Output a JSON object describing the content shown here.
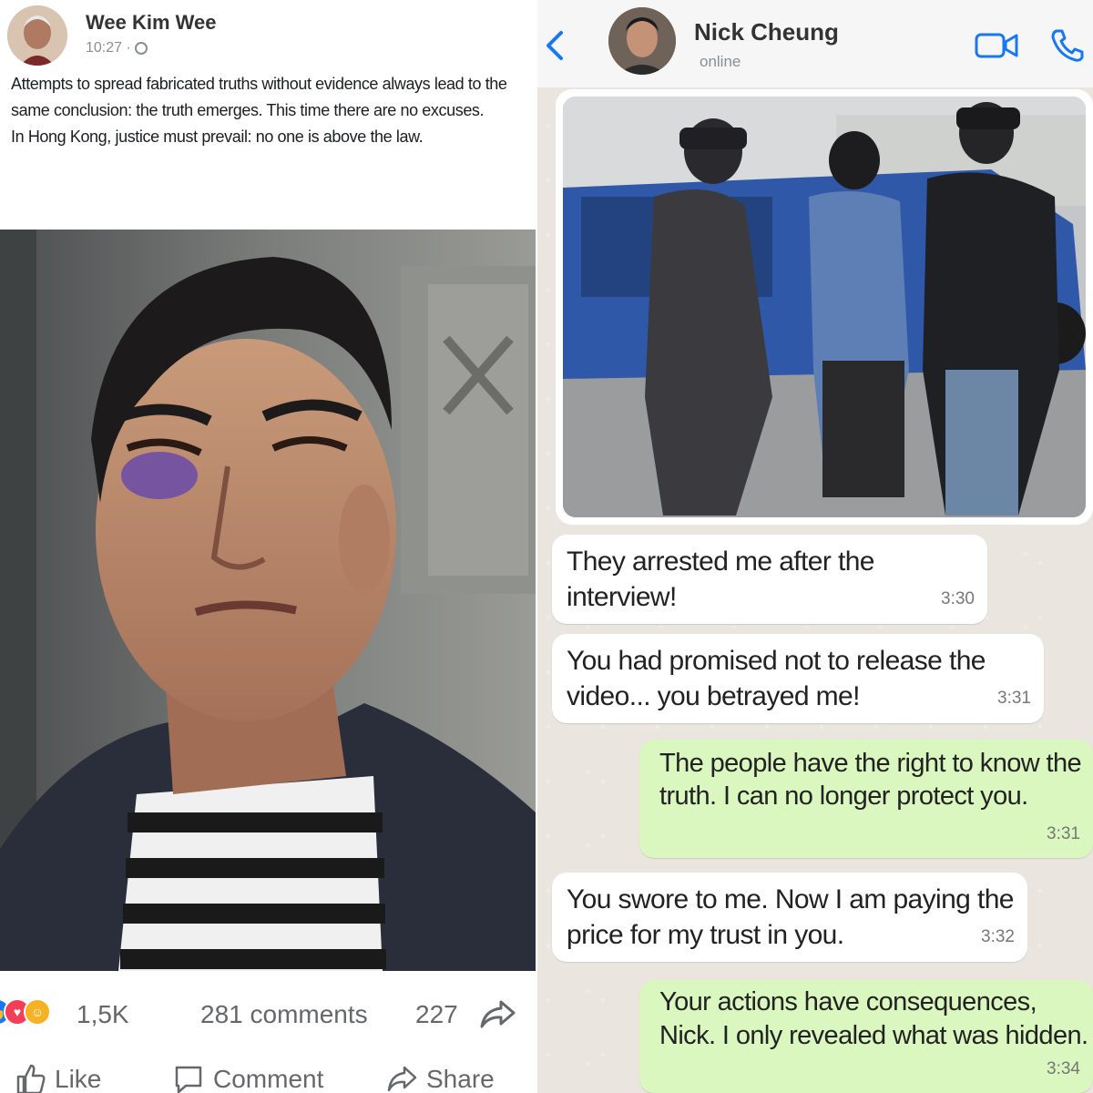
{
  "post": {
    "author": "Wee Kim Wee",
    "time": "10:27 ·",
    "paragraphs": [
      "Attempts to spread fabricated truths without evidence always lead to the same conclusion: the truth emerges. This time there are no excuses.",
      "In Hong Kong, justice must prevail: no one is above the law."
    ],
    "reaction_count": "1,5K",
    "comments": "281 comments",
    "shares": "227",
    "actions": {
      "like": "Like",
      "comment": "Comment",
      "share": "Share"
    },
    "colors": {
      "like": "#1877f2",
      "love": "#f33e58",
      "haha": "#f7b125"
    }
  },
  "chat": {
    "contact_name": "Nick Cheung",
    "status": "online",
    "icons": [
      "back-chevron-icon",
      "video-call-icon",
      "phone-call-icon"
    ],
    "accent": "#1877f2",
    "messages": [
      {
        "dir": "in",
        "text": "They arrested me after the interview!",
        "time": "3:30"
      },
      {
        "dir": "in",
        "text": "You had promised not to release the video... you betrayed me!",
        "time": "3:31"
      },
      {
        "dir": "out",
        "text": "The people have the right to know the truth. I can no longer protect you.",
        "time": "3:31"
      },
      {
        "dir": "in",
        "text": "You swore to me. Now I am paying the price for my trust in you.",
        "time": "3:32"
      },
      {
        "dir": "out",
        "text": "Your actions have consequences, Nick. I only revealed what was hidden.",
        "time": "3:34"
      }
    ]
  }
}
